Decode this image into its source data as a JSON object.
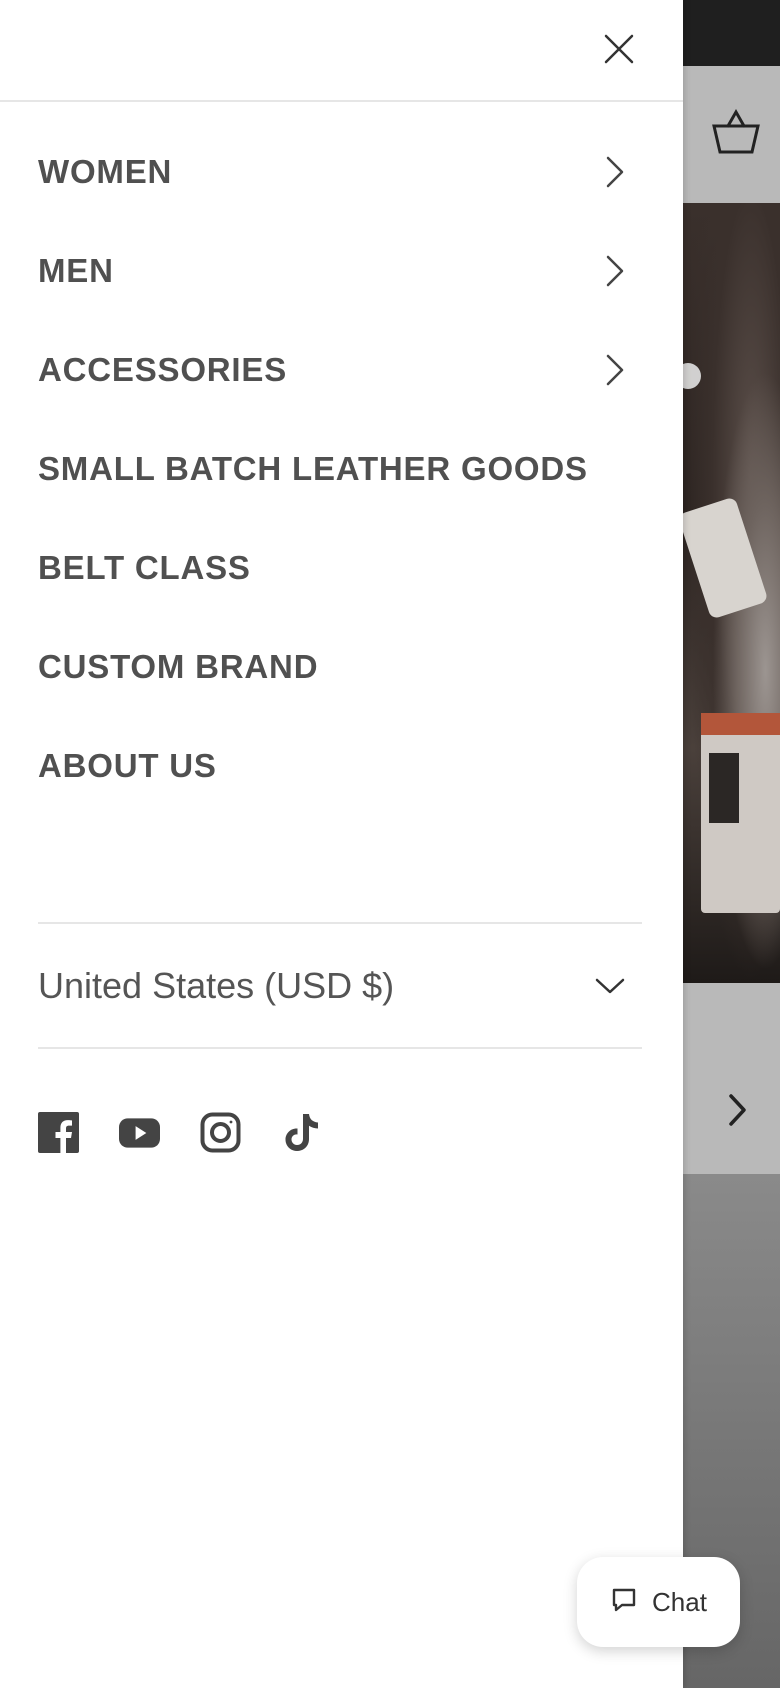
{
  "drawer": {
    "close_icon": "close-icon",
    "nav_items": [
      {
        "label": "WOMEN",
        "has_submenu": true
      },
      {
        "label": "MEN",
        "has_submenu": true
      },
      {
        "label": "ACCESSORIES",
        "has_submenu": true
      },
      {
        "label": "SMALL BATCH LEATHER GOODS",
        "has_submenu": false
      },
      {
        "label": "BELT CLASS",
        "has_submenu": false
      },
      {
        "label": "CUSTOM BRAND",
        "has_submenu": false
      },
      {
        "label": "ABOUT US",
        "has_submenu": false
      }
    ],
    "country_selector": {
      "value": "United States (USD $)",
      "icon": "chevron-down-icon"
    },
    "social": [
      "facebook-icon",
      "youtube-icon",
      "instagram-icon",
      "tiktok-icon"
    ]
  },
  "chat": {
    "label": "Chat",
    "icon": "chat-bubble-icon"
  },
  "background": {
    "cart_icon": "basket-icon",
    "next_icon": "chevron-right-icon"
  },
  "colors": {
    "text": "#505050",
    "divider": "#e6e6e6",
    "overlay": "#6b6b6b"
  }
}
